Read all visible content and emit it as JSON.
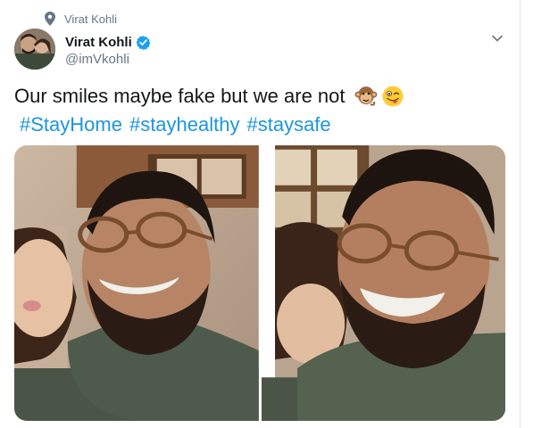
{
  "context": {
    "icon": "location-pin-icon",
    "text": "Virat Kohli"
  },
  "author": {
    "display_name": "Virat Kohli",
    "handle": "@imVkohli",
    "verified": true,
    "verified_icon": "verified-badge-icon",
    "avatar_alt": "avatar"
  },
  "tweet": {
    "text": "Our smiles maybe fake but we are not",
    "emojis": [
      "monkey-emoji-icon",
      "winking-tongue-emoji-icon"
    ],
    "hashtags": [
      "#StayHome",
      "#stayhealthy",
      "#staysafe"
    ]
  },
  "media": {
    "photo_count": 2,
    "photos": [
      {
        "name": "photo-1",
        "alt": "selfie photo 1"
      },
      {
        "name": "photo-2",
        "alt": "selfie photo 2"
      }
    ]
  },
  "colors": {
    "link": "#1b95e0",
    "verified": "#1da1f2",
    "secondary_text": "#657786",
    "primary_text": "#14171a"
  }
}
